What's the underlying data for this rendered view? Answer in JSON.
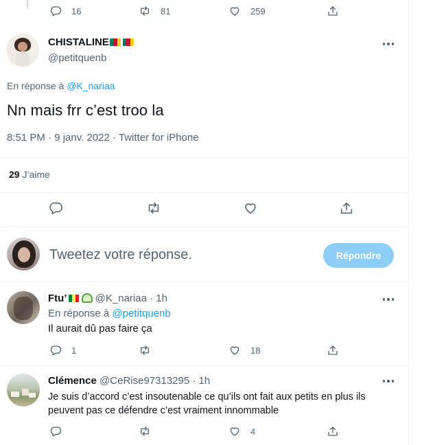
{
  "colors": {
    "accent": "#1d9bf0",
    "accent_disabled": "#8ecdf8",
    "muted": "#536471",
    "text": "#0f1419",
    "border": "#eff3f4"
  },
  "top_actions": {
    "replies": "16",
    "retweets": "81",
    "likes": "259"
  },
  "main_tweet": {
    "display_name": "CHISTALINE",
    "handle": "@petitquenb",
    "reply_prefix": "En réponse à",
    "reply_to": "@K_nariaa",
    "text": "Nn mais frr c’est troo la",
    "meta": "8:51 PM · 9 janv. 2022 · Twitter for iPhone",
    "likes_count": "29",
    "likes_label": "J’aime"
  },
  "composer": {
    "placeholder": "Tweetez votre réponse.",
    "button_label": "Répondre"
  },
  "replies": [
    {
      "display_name": "Ftu’",
      "handle": "@K_nariaa",
      "time": "· 1h",
      "reply_prefix": "En réponse à",
      "reply_to": "@petitquenb",
      "text": "Il aurait dû pas faire ça",
      "reply_count": "1",
      "retweet_count": "",
      "like_count": "18"
    },
    {
      "display_name": "Clémence",
      "handle": "@CeRise97313295",
      "time": "· 1h",
      "text_line1": "Je suis d’accord c’est insoutenable ce qu’ils ont fait aux petits en plus ils",
      "text_line2": "peuvent pas ce défendre c’est vraiment innommable",
      "reply_count": "",
      "retweet_count": "",
      "like_count": "4"
    }
  ],
  "icons": [
    "reply-icon",
    "retweet-icon",
    "like-icon",
    "share-icon",
    "more-icon",
    "cameroon-flag-icon",
    "senegal-flag-icon",
    "bitmoji-emoji-icon"
  ]
}
